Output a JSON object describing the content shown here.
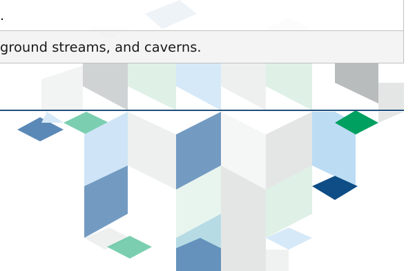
{
  "rows": [
    {
      "text": "."
    },
    {
      "text": "ground streams, and caverns."
    }
  ],
  "colors": {
    "rule": "#1f4e79",
    "steel_blue": "#5b89b7",
    "light_blue": "#bcdcf4",
    "teal": "#4fbf96",
    "green": "#00a060",
    "navy": "#0e4d85",
    "gray": "#b8bcbd",
    "mint": "#d9eee3"
  }
}
